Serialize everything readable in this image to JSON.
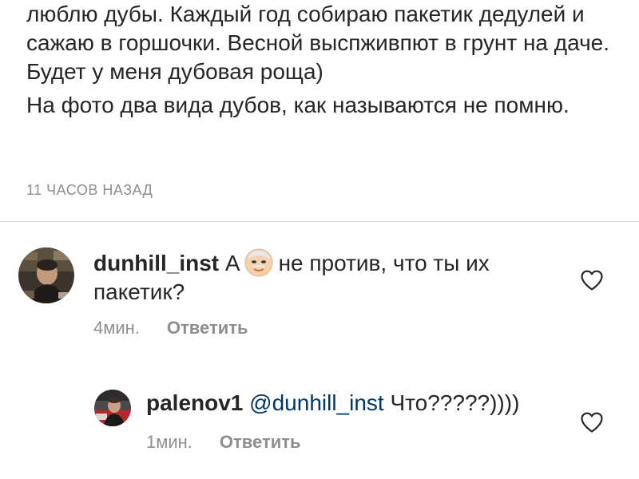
{
  "caption": {
    "paragraph1": "люблю дубы. Каждый год собираю пакетик дедулей и сажаю в горшочки. Весной выспживпют в грунт на даче. Будет у меня дубовая роща)",
    "paragraph2": "На фото два вида дубов,  как называются не помню.",
    "timestamp": "11 ЧАСОВ НАЗАД"
  },
  "comments": [
    {
      "username": "dunhill_inst",
      "text_before_emoji": "А",
      "emoji": "old-man-emoji",
      "text_after_emoji": "не против, что ты их пакетик?",
      "time": "4мин.",
      "reply_label": "Ответить"
    },
    {
      "username": "palenov1",
      "mention": "@dunhill_inst",
      "text": "Что?????))))",
      "time": "1мин.",
      "reply_label": "Ответить"
    }
  ],
  "icons": {
    "like": "heart-outline-icon"
  },
  "colors": {
    "text": "#262626",
    "secondary": "#8e8e8e",
    "mention": "#00376b",
    "divider": "#dbdbdb"
  }
}
